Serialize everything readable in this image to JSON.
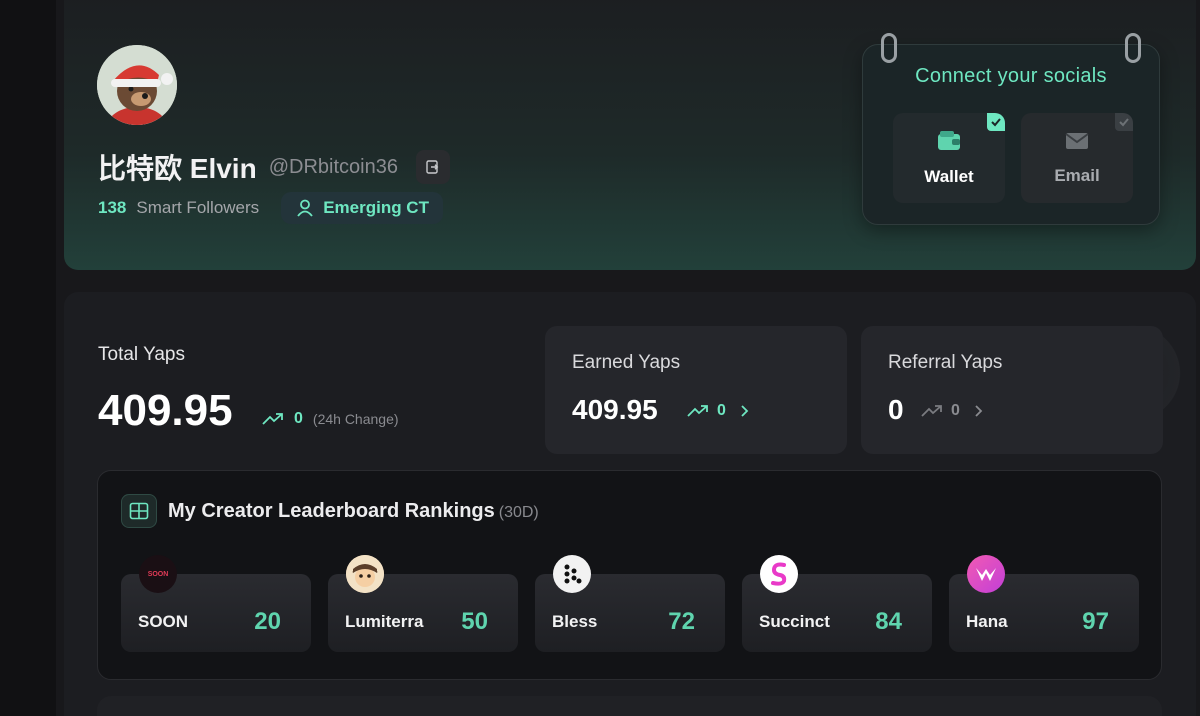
{
  "profile": {
    "display_name": "比特欧 Elvin",
    "handle": "@DRbitcoin36",
    "smart_followers_count": "138",
    "smart_followers_label": "Smart Followers",
    "badge": "Emerging CT"
  },
  "socials": {
    "title": "Connect your socials",
    "wallet_label": "Wallet",
    "email_label": "Email"
  },
  "stats": {
    "total_title": "Total Yaps",
    "total_value": "409.95",
    "total_change": "0",
    "total_change_label": "(24h Change)",
    "earned_title": "Earned Yaps",
    "earned_value": "409.95",
    "earned_change": "0",
    "referral_title": "Referral Yaps",
    "referral_value": "0",
    "referral_change": "0"
  },
  "leaderboard": {
    "title": "My Creator Leaderboard Rankings",
    "period": "(30D)",
    "items": [
      {
        "name": "SOON",
        "rank": "20",
        "logo_text": "SOON"
      },
      {
        "name": "Lumiterra",
        "rank": "50"
      },
      {
        "name": "Bless",
        "rank": "72"
      },
      {
        "name": "Succinct",
        "rank": "84"
      },
      {
        "name": "Hana",
        "rank": "97"
      }
    ]
  },
  "colors": {
    "accent": "#6ee7c1",
    "rank": "#5fd4ae",
    "panel": "#1c1d21"
  }
}
